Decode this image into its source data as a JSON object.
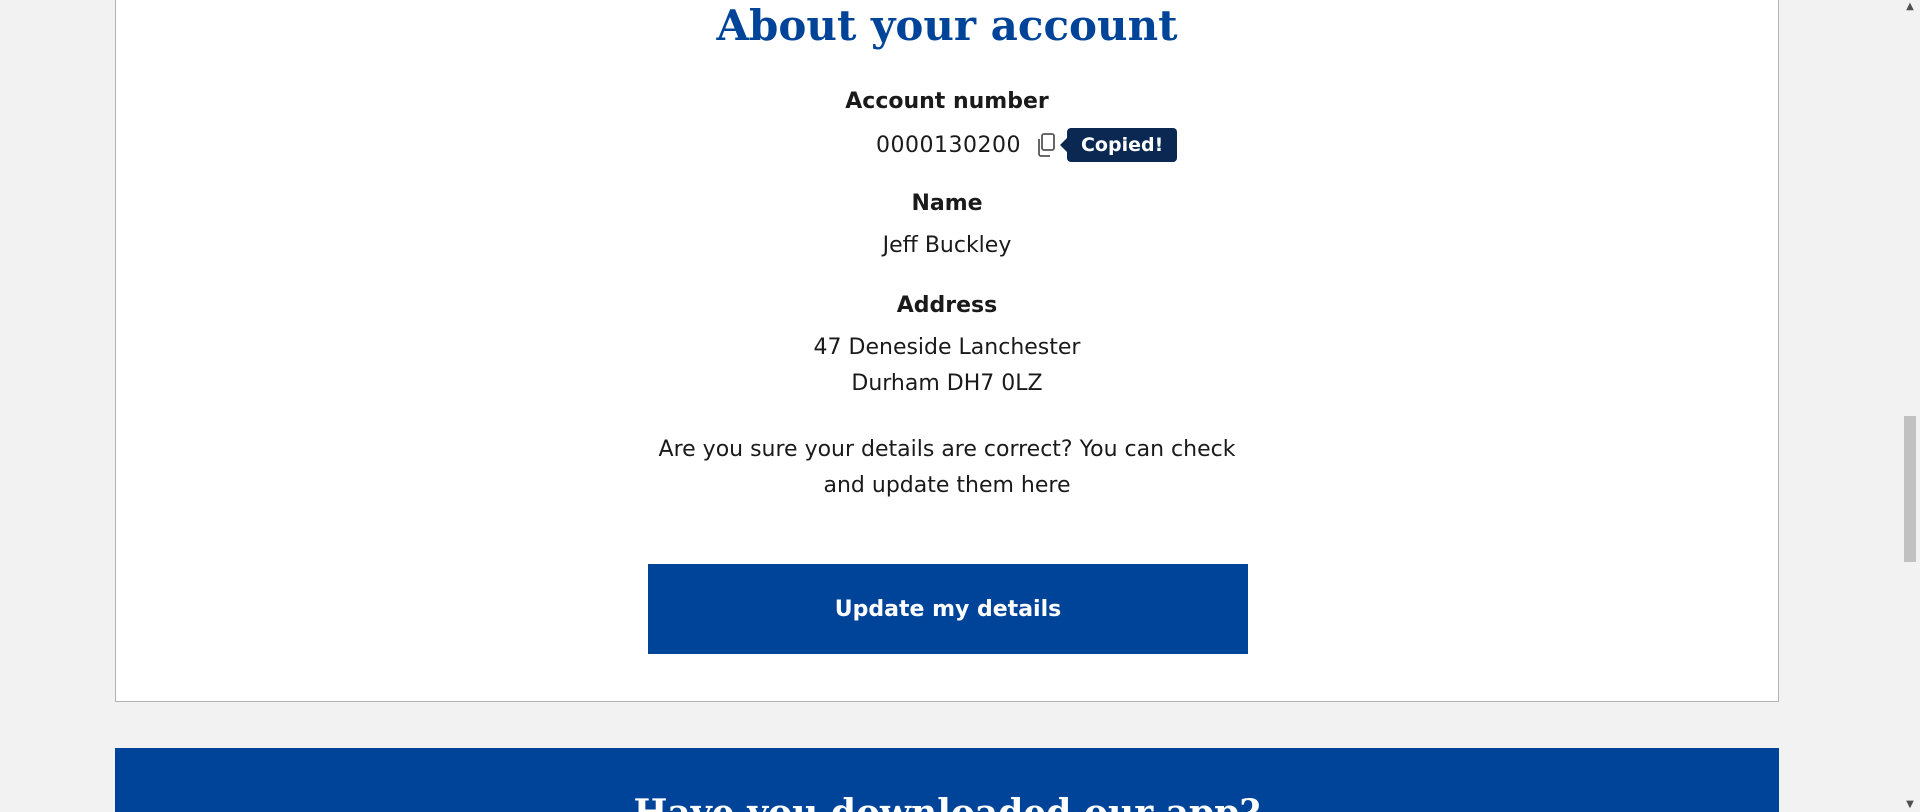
{
  "section": {
    "title": "About your account",
    "account_number_label": "Account number",
    "account_number": "0000130200",
    "copied_tooltip": "Copied!",
    "name_label": "Name",
    "name": "Jeff Buckley",
    "address_label": "Address",
    "address_line1": "47 Deneside Lanchester",
    "address_line2": "Durham DH7 0LZ",
    "check_text_line1": "Are you sure your details are correct? You can check",
    "check_text_line2": "and update them here",
    "update_button": "Update my details"
  },
  "banner": {
    "title": "Have you downloaded our app?"
  },
  "colors": {
    "brand_blue": "#00449a",
    "tooltip_bg": "#0a2851"
  },
  "icons": {
    "copy": "copy-icon"
  }
}
